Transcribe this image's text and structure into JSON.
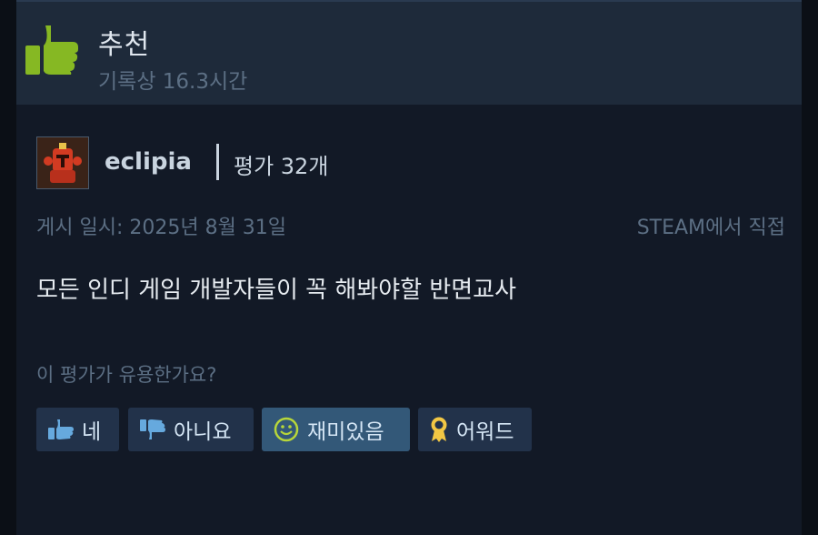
{
  "header": {
    "title": "추천",
    "hours": "기록상 16.3시간",
    "icon": "thumbs-up-icon"
  },
  "author": {
    "name": "eclipia",
    "review_count": "평가 32개",
    "avatar": "knight-avatar"
  },
  "meta": {
    "posted": "게시 일시: 2025년 8월 31일",
    "source": "STEAM에서 직접"
  },
  "review": {
    "text": "모든 인디 게임 개발자들이 꼭 해봐야할 반면교사"
  },
  "helpful_prompt": "이 평가가 유용한가요?",
  "buttons": {
    "yes": "네",
    "no": "아니요",
    "funny": "재미있음",
    "award": "어워드"
  },
  "colors": {
    "thumb_green": "#86b823",
    "button_bg": "#22324a",
    "button_active": "#335878",
    "award_gold": "#f2c744",
    "icon_blue": "#66a9de"
  }
}
